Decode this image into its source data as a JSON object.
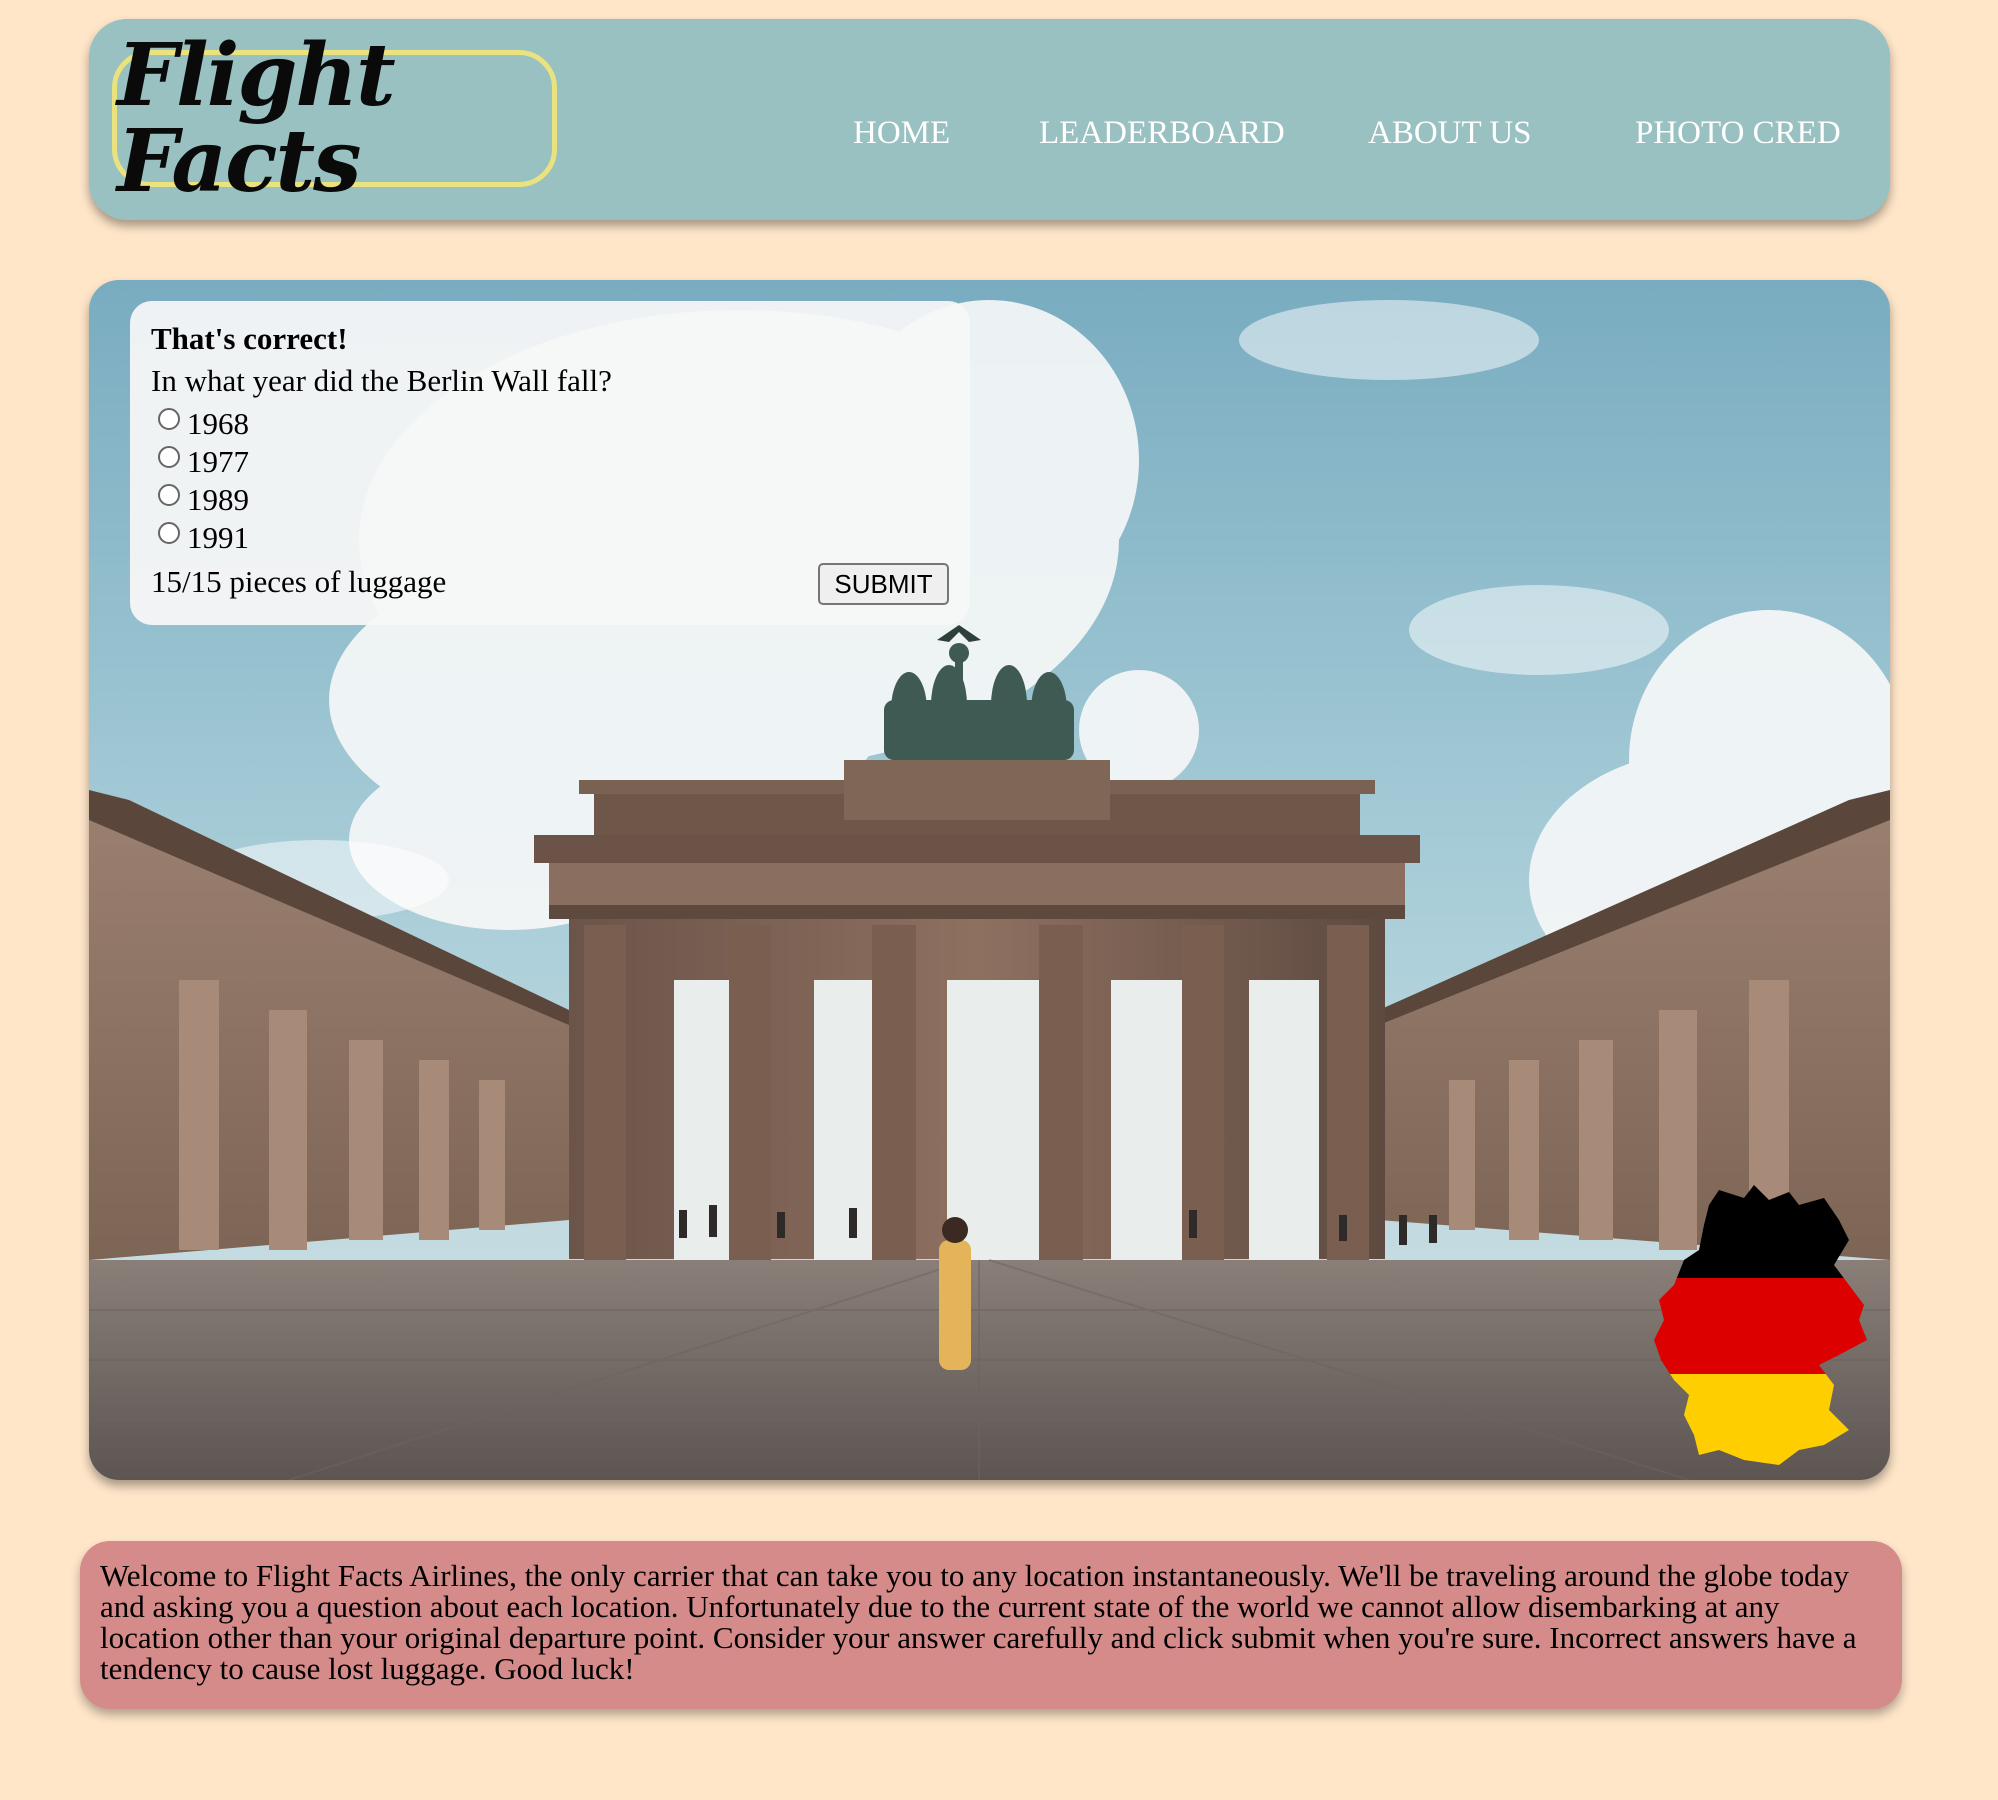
{
  "header": {
    "logo": "Flight Facts",
    "nav": [
      "HOME",
      "LEADERBOARD",
      "ABOUT US",
      "PHOTO CRED"
    ]
  },
  "quiz": {
    "status": "That's correct!",
    "question": "In what year did the Berlin Wall fall?",
    "options": [
      "1968",
      "1977",
      "1989",
      "1991"
    ],
    "luggage": "15/15 pieces of luggage",
    "submit_label": "SUBMIT"
  },
  "scene": {
    "landmark": "brandenburg-gate-photo",
    "flag": "germany-flag-map",
    "flag_colors": [
      "#000000",
      "#dd0000",
      "#ffce00"
    ]
  },
  "welcome": "Welcome to Flight Facts Airlines, the only carrier that can take you to any location instantaneously. We'll be traveling around the globe today and asking you a question about each location. Unfortunately due to the current state of the world we cannot allow disembarking at any location other than your original departure point. Consider your answer carefully and click submit when you're sure. Incorrect answers have a tendency to cause lost luggage. Good luck!",
  "colors": {
    "page_bg": "#ffe6c9",
    "header_bg": "#99c1c2",
    "logo_border": "#eae27e",
    "welcome_bg": "#d48b89"
  }
}
